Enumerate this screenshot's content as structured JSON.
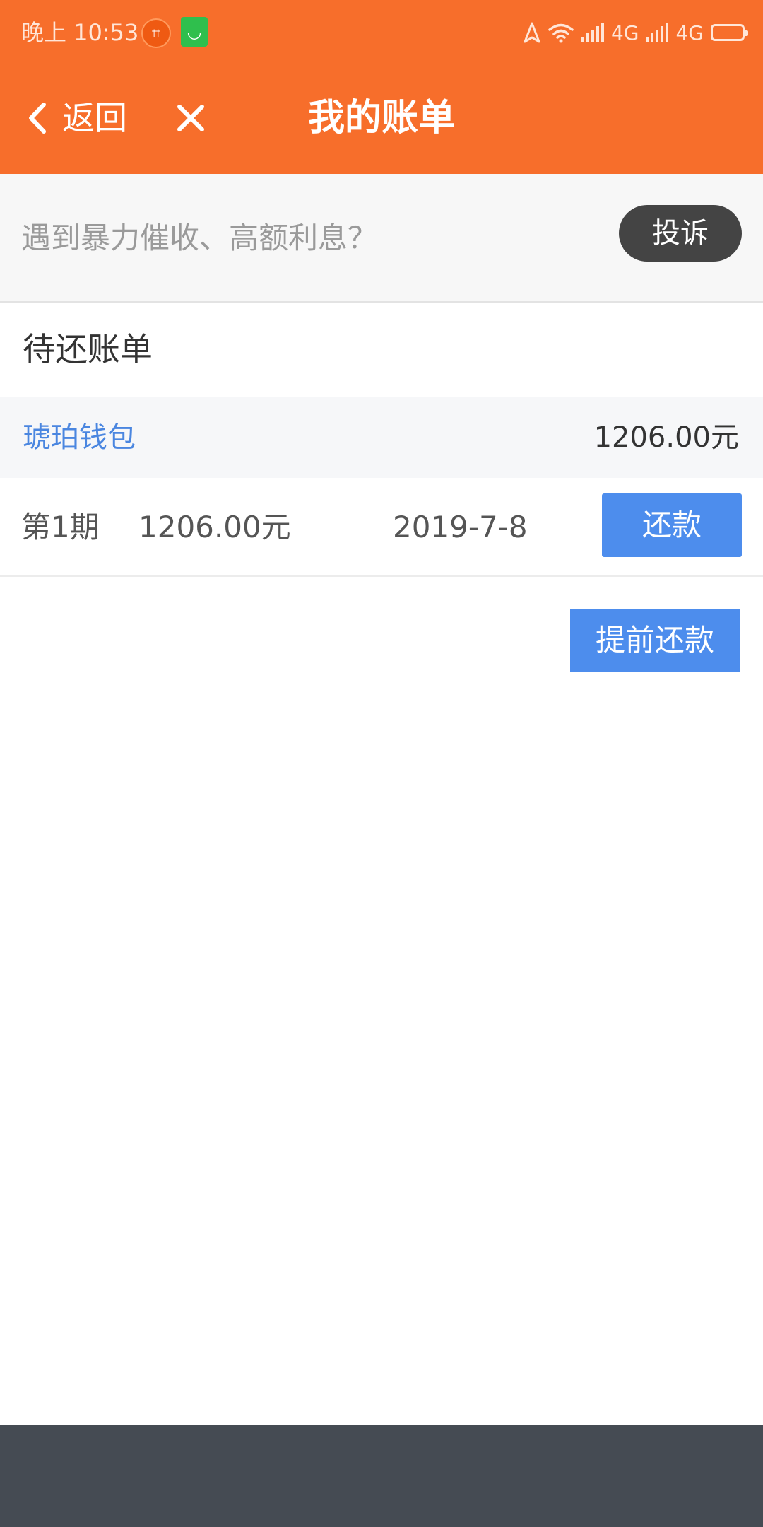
{
  "status_bar": {
    "time": "晚上 10:53",
    "network_1": "4G",
    "network_2": "4G",
    "icons": [
      "crop-app-icon",
      "shopping-bag-app-icon",
      "location-icon",
      "wifi-icon",
      "signal-icon",
      "battery-icon"
    ]
  },
  "nav": {
    "back_label": "返回",
    "title": "我的账单",
    "icons": [
      "chevron-left-icon",
      "close-icon"
    ]
  },
  "banner": {
    "text": "遇到暴力催收、高额利息？",
    "complain_label": "投诉"
  },
  "bills": {
    "section_title": "待还账单",
    "platform": {
      "name": "琥珀钱包",
      "amount": "1206.00元"
    },
    "installments": [
      {
        "period": "第1期",
        "amount": "1206.00元",
        "date": "2019-7-8",
        "action_label": "还款"
      }
    ],
    "prepay_label": "提前还款"
  },
  "colors": {
    "header": "#f76e2b",
    "accent_blue": "#4d8ded",
    "link_blue": "#4a86e0",
    "complain_button": "#444444",
    "bottom_bar": "#454b53"
  }
}
